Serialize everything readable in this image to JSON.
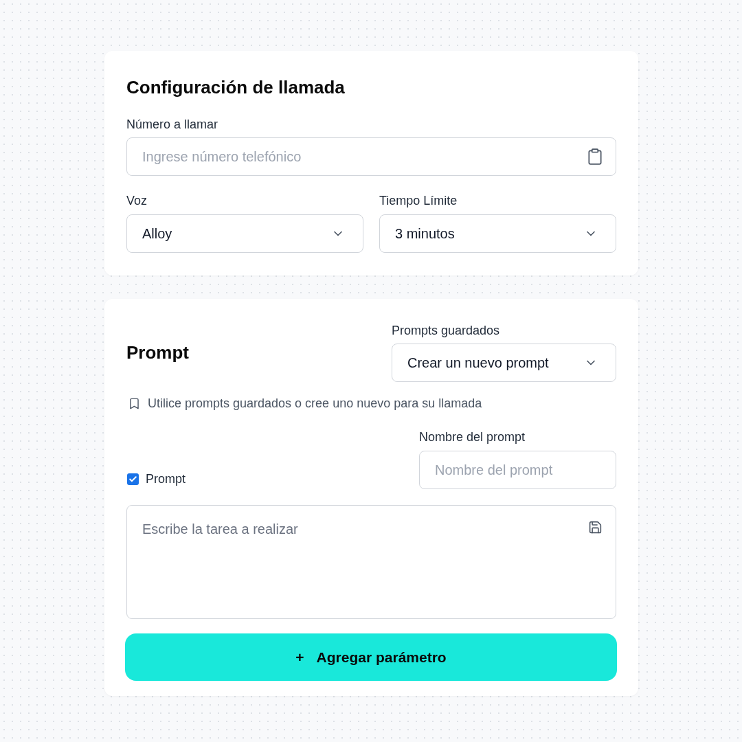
{
  "call_config": {
    "title": "Configuración de llamada",
    "phone": {
      "label": "Número a llamar",
      "placeholder": "Ingrese número telefónico"
    },
    "voice": {
      "label": "Voz",
      "value": "Alloy"
    },
    "time_limit": {
      "label": "Tiempo Límite",
      "value": "3 minutos"
    }
  },
  "prompt_section": {
    "title": "Prompt",
    "saved_prompts": {
      "label": "Prompts guardados",
      "value": "Crear un nuevo prompt"
    },
    "hint": "Utilice prompts guardados o cree uno nuevo para su llamada",
    "prompt_checkbox": {
      "label": "Prompt",
      "checked": true
    },
    "prompt_name": {
      "label": "Nombre del prompt",
      "placeholder": "Nombre del prompt"
    },
    "task": {
      "placeholder": "Escribe la tarea a realizar"
    }
  },
  "add_button": {
    "icon": "+",
    "label": "Agregar parámetro"
  }
}
